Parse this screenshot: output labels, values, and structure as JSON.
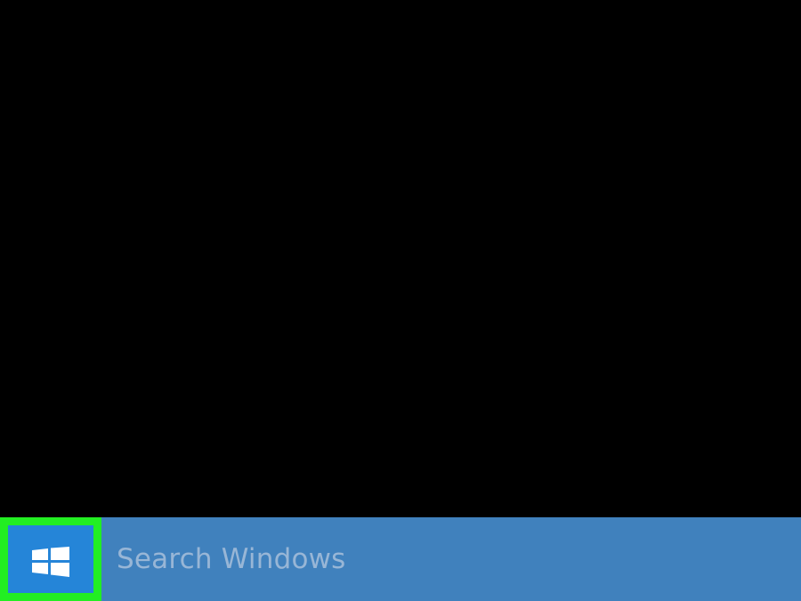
{
  "taskbar": {
    "start_icon": "windows-logo-icon",
    "search": {
      "placeholder": "Search Windows"
    }
  },
  "colors": {
    "desktop_background": "#000000",
    "taskbar_background": "#4081bd",
    "start_button_background": "#2585d8",
    "highlight_border": "#22ee22",
    "placeholder_text": "#98b6d6"
  }
}
